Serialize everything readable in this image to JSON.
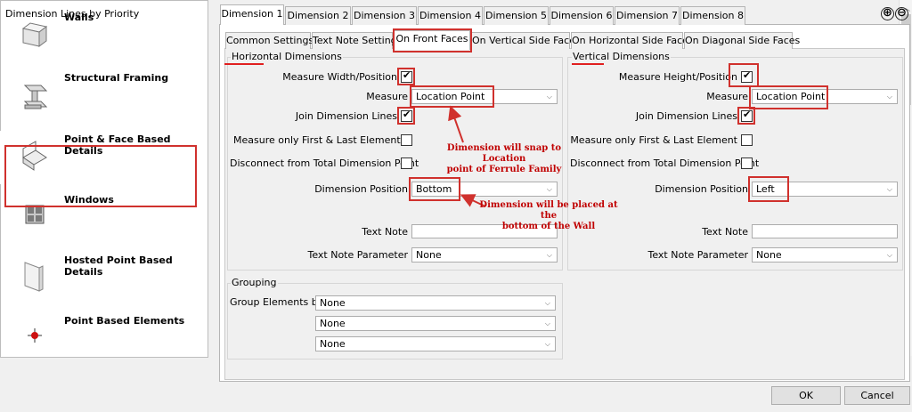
{
  "left": {
    "title": "Dimension Lines by Priority",
    "categories": [
      {
        "label": "Walls",
        "icon": "wall-icon"
      },
      {
        "label": "Structural Framing",
        "icon": "beam-icon"
      },
      {
        "label": "Point & Face Based Details",
        "icon": "face-detail-icon"
      },
      {
        "label": "Windows",
        "icon": "window-icon"
      },
      {
        "label": "Hosted Point Based Details",
        "icon": "panel-icon"
      },
      {
        "label": "Point Based Elements",
        "icon": "point-icon"
      }
    ]
  },
  "tabs": [
    "Dimension 1",
    "Dimension 2",
    "Dimension 3",
    "Dimension 4",
    "Dimension 5",
    "Dimension 6",
    "Dimension 7",
    "Dimension 8"
  ],
  "subtabs": [
    "Common Settings",
    "Text Note Settings",
    "On Front Faces",
    "On Vertical Side Faces",
    "On Horizontal Side Faces",
    "On Diagonal Side Faces"
  ],
  "add_icon": "⊕",
  "remove_icon": "⊖",
  "horizontal": {
    "title": "Horizontal Dimensions",
    "measure_width_label": "Measure Width/Position",
    "measure_label": "Measure",
    "measure_value": "Location Point",
    "join_label": "Join Dimension Lines",
    "first_last_label": "Measure only First & Last Element",
    "disconnect_label": "Disconnect from Total Dimension Point",
    "position_label": "Dimension Position",
    "position_value": "Bottom",
    "text_note_label": "Text Note",
    "text_note_value": "",
    "text_param_label": "Text Note Parameter",
    "text_param_value": "None"
  },
  "vertical": {
    "title": "Vertical Dimensions",
    "measure_height_label": "Measure Height/Position",
    "measure_label": "Measure",
    "measure_value": "Location Point",
    "join_label": "Join Dimension Lines",
    "first_last_label": "Measure only First & Last Element",
    "disconnect_label": "Disconnect from Total Dimension Point",
    "position_label": "Dimension Position",
    "position_value": "Left",
    "text_note_label": "Text Note",
    "text_note_value": "",
    "text_param_label": "Text Note Parameter",
    "text_param_value": "None"
  },
  "grouping": {
    "title": "Grouping",
    "group_by_label": "Group Elements by",
    "values": [
      "None",
      "None",
      "None"
    ]
  },
  "annotations": {
    "snap_note_1": "Dimension will snap to Location",
    "snap_note_2": "point of Ferrule Family",
    "bottom_note_1": "Dimension will be placed at the",
    "bottom_note_2": "bottom of the  Wall"
  },
  "buttons": {
    "ok": "OK",
    "cancel": "Cancel"
  },
  "colors": {
    "annotation_red": "#d0312d"
  }
}
